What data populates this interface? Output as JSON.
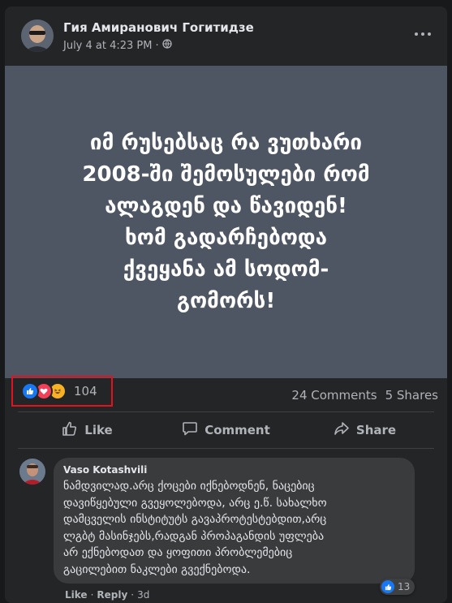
{
  "post": {
    "author": "Гия Амиранович Гогитидзе",
    "timestamp": "July 4 at 4:23 PM",
    "separator": "·",
    "privacy_icon": "globe-icon",
    "image_text": "იმ რუსებსაც რა ვუთხარი\n2008-ში შემოსულები რომ\nალაგდენ და წავიდენ!\nხომ გადარჩებოდა\nქვეყანა ამ სოდომ-\nგომორს!",
    "image_bg": "#4e5563"
  },
  "reactions": {
    "icons": [
      "like-icon",
      "love-icon",
      "haha-icon"
    ],
    "count": "104",
    "comments": "24 Comments",
    "shares": "5 Shares",
    "highlight_color": "#e0141e"
  },
  "actions": {
    "like": "Like",
    "comment": "Comment",
    "share": "Share"
  },
  "comment": {
    "author": "Vaso Kotashvili",
    "text": "ნამდვილად.არც ქოცები იქნებოდნენ, ნაცებიც\nდავიწყებული გვეყოლებოდა, არც ე.წ. სახალხო\nდამცველის ინსტიტუტს გავაპროტესტებდით,არც\nლგბტ მასინჯებს,რადგან პროპაგანდის უფლება\nარ ექნებოდათ და ყოფითი პრობლემებიც\nგაცილებით ნაკლები გვექნებოდა.",
    "reaction_icon": "like-icon",
    "reaction_count": "13",
    "like_label": "Like",
    "reply_label": "Reply",
    "separator": "·",
    "time": "3d"
  },
  "colors": {
    "background": "#18191a",
    "card": "#242526",
    "bubble": "#3a3b3c",
    "like_blue": "#1877f2",
    "love_red": "#f33e58",
    "haha_yellow": "#f7b125"
  }
}
